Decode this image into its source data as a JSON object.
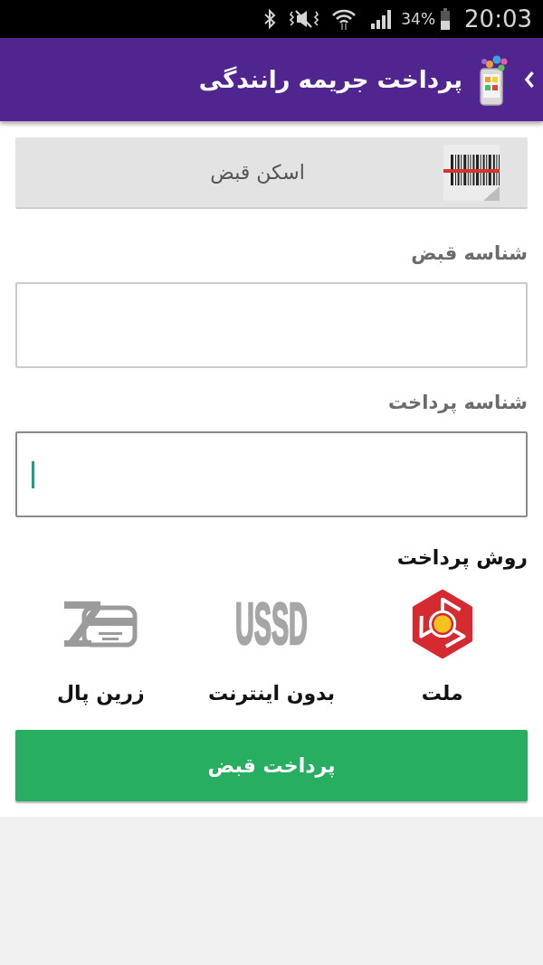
{
  "status_bar": {
    "battery": "34%",
    "time": "20:03"
  },
  "app_bar": {
    "title": "پرداخت جریمه رانندگی"
  },
  "scan_button": {
    "label": "اسکن قبض"
  },
  "fields": [
    {
      "label": "شناسه قبض",
      "focused": false
    },
    {
      "label": "شناسه پرداخت",
      "focused": true
    }
  ],
  "payment": {
    "heading": "روش پرداخت",
    "methods": [
      {
        "kind": "mellat",
        "label": "ملت"
      },
      {
        "kind": "ussd",
        "logo_text": "USSD",
        "label": "بدون اینترنت"
      },
      {
        "kind": "zarinpal",
        "label": "زرین پال"
      }
    ]
  },
  "submit_button": {
    "label": "پرداخت قبض"
  }
}
